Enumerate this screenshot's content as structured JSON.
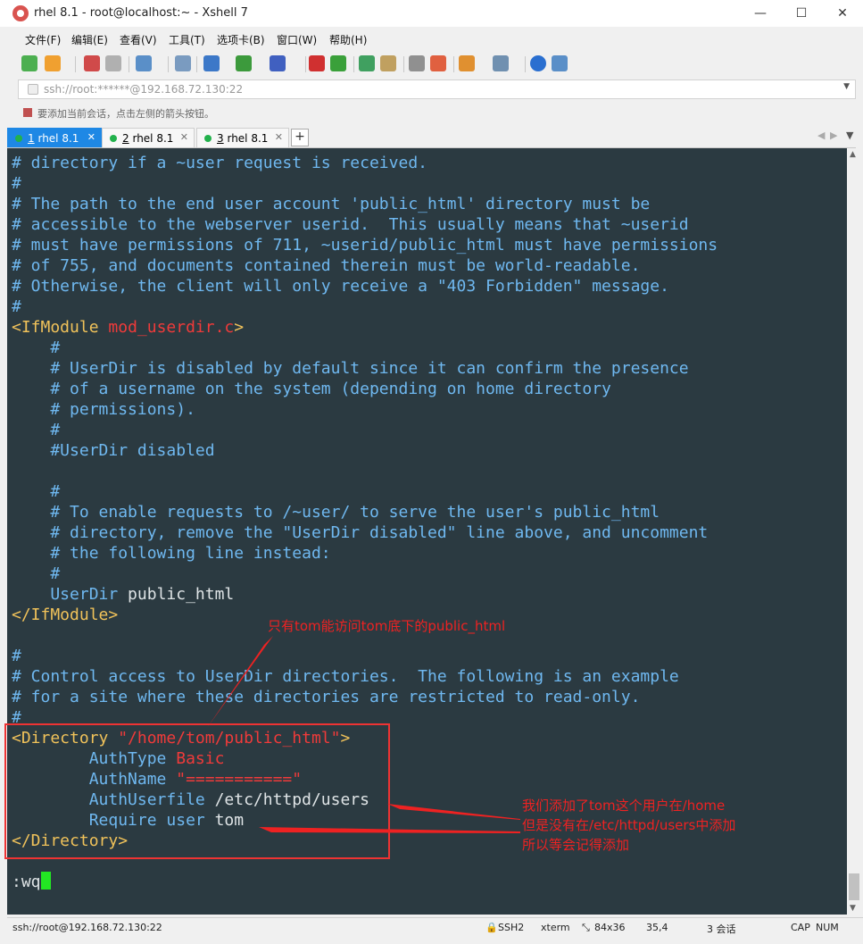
{
  "window": {
    "title": "rhel 8.1 - root@localhost:~ - Xshell 7",
    "minimize": "—",
    "maximize": "☐",
    "close": "✕"
  },
  "menu": [
    "文件(F)",
    "编辑(E)",
    "查看(V)",
    "工具(T)",
    "选项卡(B)",
    "窗口(W)",
    "帮助(H)"
  ],
  "address": {
    "value": "ssh://root:******@192.168.72.130:22"
  },
  "hint": "要添加当前会话，点击左侧的箭头按钮。",
  "tabs": [
    {
      "num": "1",
      "label": "rhel 8.1",
      "close": "✕"
    },
    {
      "num": "2",
      "label": "rhel 8.1",
      "close": "✕"
    },
    {
      "num": "3",
      "label": "rhel 8.1",
      "close": "✕"
    }
  ],
  "tab_add": "+",
  "terminal": {
    "lines": [
      "# directory if a ~user request is received.",
      "#",
      "# The path to the end user account 'public_html' directory must be",
      "# accessible to the webserver userid.  This usually means that ~userid",
      "# must have permissions of 711, ~userid/public_html must have permissions",
      "# of 755, and documents contained therein must be world-readable.",
      "# Otherwise, the client will only receive a \"403 Forbidden\" message.",
      "#"
    ],
    "ifmodule_open": "<IfModule",
    "ifmodule_arg": "mod_userdir.c",
    "ifmodule_gt": ">",
    "block1": [
      "    #",
      "    # UserDir is disabled by default since it can confirm the presence",
      "    # of a username on the system (depending on home directory",
      "    # permissions).",
      "    #",
      "    #UserDir disabled"
    ],
    "block2": [
      "    #",
      "    # To enable requests to /~user/ to serve the user's public_html",
      "    # directory, remove the \"UserDir disabled\" line above, and uncomment",
      "    # the following line instead:",
      "    #"
    ],
    "userdir_kw": "    UserDir",
    "userdir_val": " public_html",
    "ifmodule_close": "</IfModule>",
    "block3": [
      "#",
      "# Control access to UserDir directories.  The following is an example",
      "# for a site where these directories are restricted to read-only.",
      "#"
    ],
    "dir_open": "<Directory",
    "dir_path": " \"/home/tom/public_html\"",
    "dir_gt": ">",
    "authtype_kw": "        AuthType",
    "authtype_val": " Basic",
    "authname_kw": "        AuthName",
    "authname_val": " \"===========\"",
    "authuserfile_kw": "        AuthUserfile",
    "authuserfile_val": " /etc/httpd/users",
    "require_kw": "        Require user",
    "require_val": " tom",
    "dir_close": "</Directory>",
    "command": ":wq"
  },
  "annotations": {
    "top": "只有tom能访问tom底下的public_html",
    "right_lines": [
      "我们添加了tom这个用户在/home",
      "但是没有在/etc/httpd/users中添加",
      "所以等会记得添加"
    ]
  },
  "status": {
    "connection": "ssh://root@192.168.72.130:22",
    "protocol": "SSH2",
    "term": "xterm",
    "size": "84x36",
    "pos": "35,4",
    "sessions": "3 会话",
    "caps": "CAP",
    "num": "NUM"
  },
  "colors": {
    "terminal_bg": "#2b3a41",
    "comment": "#6fb8f0",
    "tag": "#f0c25a",
    "string": "#f03a3a",
    "annotation": "#ee3333",
    "cursor": "#23e823",
    "active_tab": "#1e88e5"
  }
}
